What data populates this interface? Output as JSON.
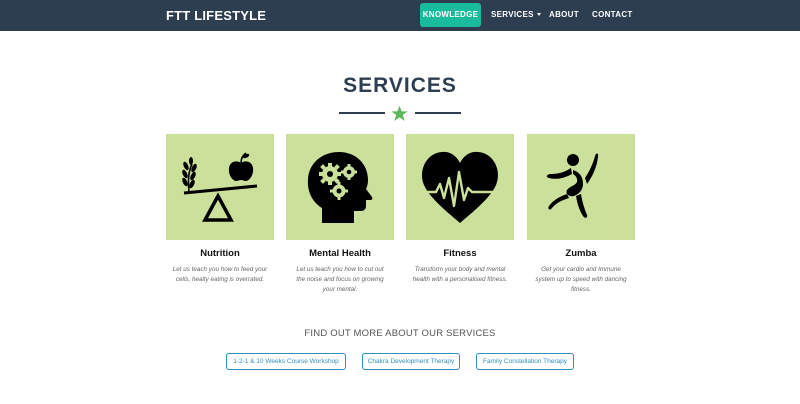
{
  "navbar": {
    "brand": "FTT LIFESTYLE",
    "items": [
      {
        "label": "KNOWLEDGE",
        "active": true
      },
      {
        "label": "SERVICES",
        "dropdown": true
      },
      {
        "label": "ABOUT"
      },
      {
        "label": "CONTACT"
      }
    ]
  },
  "services": {
    "title": "SERVICES",
    "divider_icon": "star-icon",
    "cards": [
      {
        "title": "Nutrition",
        "text": "Let us teach you how to feed your cells, healty eating is overrated.",
        "icon": "balance-scale-apple-icon"
      },
      {
        "title": "Mental Health",
        "text": "Let us teach you how to cut out the noise and focus on growing your mental.",
        "icon": "head-gears-icon"
      },
      {
        "title": "Fitness",
        "text": "Transform your body and mental health with a personalised fitness.",
        "icon": "heartbeat-icon"
      },
      {
        "title": "Zumba",
        "text": "Get your cardio and Immune system up to speed with dancing fitness.",
        "icon": "dancer-icon"
      }
    ]
  },
  "more": {
    "title": "FIND OUT MORE ABOUT OUR SERVICES",
    "buttons": [
      "1-2-1 & 10 Weeks Course Workshop",
      "Chakra Development Therapy",
      "Family Constellation Therapy"
    ]
  },
  "colors": {
    "navbar_bg": "#2c3e50",
    "accent": "#18bc9c",
    "card_bg": "#cbe09a",
    "star": "#5cb85c",
    "button_border": "#2f8fbf"
  }
}
